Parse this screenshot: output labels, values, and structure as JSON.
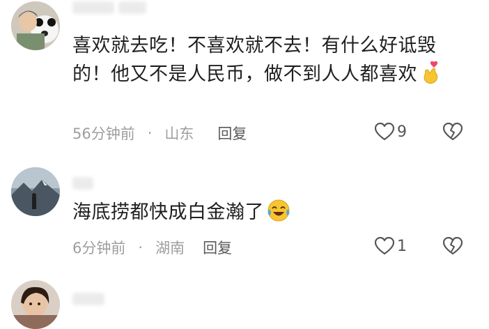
{
  "comments": [
    {
      "text": "喜欢就去吃！不喜欢就不去！有什么好诋毁的！他又不是人民币，做不到人人都喜欢",
      "emoji": "finger-heart-emoji",
      "time": "56分钟前",
      "separator": "·",
      "location": "山东",
      "reply_label": "回复",
      "like_count": "9"
    },
    {
      "text": "海底捞都快成白金瀚了",
      "emoji": "laughing-crying-emoji",
      "time": "6分钟前",
      "separator": "·",
      "location": "湖南",
      "reply_label": "回复",
      "like_count": "1"
    },
    {
      "text": "",
      "time": "",
      "location": ""
    }
  ],
  "icons": {
    "like": "heart-outline-icon",
    "dislike": "broken-heart-icon"
  },
  "colors": {
    "meta_text": "#9e9e9e",
    "body_text": "#1f1f1f",
    "reply_text": "#5a5a5a"
  }
}
